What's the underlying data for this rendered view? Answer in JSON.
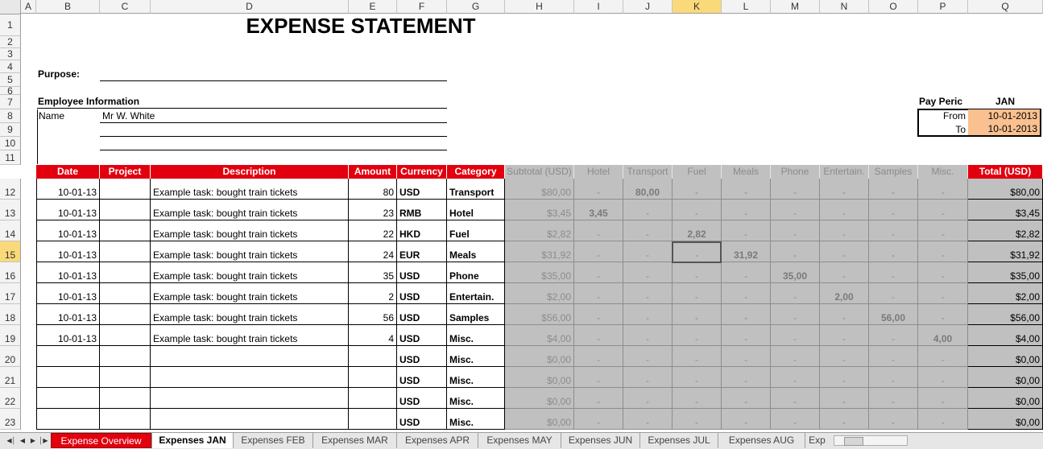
{
  "columns": [
    "A",
    "B",
    "C",
    "D",
    "E",
    "F",
    "G",
    "H",
    "I",
    "J",
    "K",
    "L",
    "M",
    "N",
    "O",
    "P",
    "Q"
  ],
  "selected_column": "K",
  "rows": [
    "1",
    "2",
    "3",
    "4",
    "5",
    "6",
    "7",
    "8",
    "9",
    "10",
    "11",
    "12",
    "13",
    "14",
    "15",
    "16",
    "17",
    "18",
    "19",
    "20",
    "21",
    "22",
    "23"
  ],
  "selected_row": "15",
  "sheet": {
    "title": "EXPENSE STATEMENT",
    "purpose_label": "Purpose:",
    "employee_info_label": "Employee Information",
    "name_label": "Name",
    "name_value": "Mr W. White",
    "pay_period_label": "Pay Peric",
    "pay_period_month": "JAN",
    "from_label": "From",
    "from_value": "10-01-2013",
    "to_label": "To",
    "to_value": "10-01-2013"
  },
  "table": {
    "headers": [
      "Date",
      "Project",
      "Description",
      "Amount",
      "Currency",
      "Category",
      "Subtotal (USD)",
      "Hotel",
      "Transport",
      "Fuel",
      "Meals",
      "Phone",
      "Entertain.",
      "Samples",
      "Misc.",
      "Total (USD)"
    ],
    "rows": [
      {
        "date": "10-01-13",
        "project": "",
        "description": "Example task: bought train tickets",
        "amount": "80",
        "currency": "USD",
        "category": "Transport",
        "subtotal": "$80,00",
        "hotel": "-",
        "transport": "80,00",
        "fuel": "-",
        "meals": "-",
        "phone": "-",
        "entertain": "-",
        "samples": "-",
        "misc": "-",
        "total": "$80,00"
      },
      {
        "date": "10-01-13",
        "project": "",
        "description": "Example task: bought train tickets",
        "amount": "23",
        "currency": "RMB",
        "category": "Hotel",
        "subtotal": "$3,45",
        "hotel": "3,45",
        "transport": "-",
        "fuel": "-",
        "meals": "-",
        "phone": "-",
        "entertain": "-",
        "samples": "-",
        "misc": "-",
        "total": "$3,45"
      },
      {
        "date": "10-01-13",
        "project": "",
        "description": "Example task: bought train tickets",
        "amount": "22",
        "currency": "HKD",
        "category": "Fuel",
        "subtotal": "$2,82",
        "hotel": "-",
        "transport": "-",
        "fuel": "2,82",
        "meals": "-",
        "phone": "-",
        "entertain": "-",
        "samples": "-",
        "misc": "-",
        "total": "$2,82"
      },
      {
        "date": "10-01-13",
        "project": "",
        "description": "Example task: bought train tickets",
        "amount": "24",
        "currency": "EUR",
        "category": "Meals",
        "subtotal": "$31,92",
        "hotel": "-",
        "transport": "-",
        "fuel": "-",
        "meals": "31,92",
        "phone": "-",
        "entertain": "-",
        "samples": "-",
        "misc": "-",
        "total": "$31,92"
      },
      {
        "date": "10-01-13",
        "project": "",
        "description": "Example task: bought train tickets",
        "amount": "35",
        "currency": "USD",
        "category": "Phone",
        "subtotal": "$35,00",
        "hotel": "-",
        "transport": "-",
        "fuel": "-",
        "meals": "-",
        "phone": "35,00",
        "entertain": "-",
        "samples": "-",
        "misc": "-",
        "total": "$35,00"
      },
      {
        "date": "10-01-13",
        "project": "",
        "description": "Example task: bought train tickets",
        "amount": "2",
        "currency": "USD",
        "category": "Entertain.",
        "subtotal": "$2,00",
        "hotel": "-",
        "transport": "-",
        "fuel": "-",
        "meals": "-",
        "phone": "-",
        "entertain": "2,00",
        "samples": "-",
        "misc": "-",
        "total": "$2,00"
      },
      {
        "date": "10-01-13",
        "project": "",
        "description": "Example task: bought train tickets",
        "amount": "56",
        "currency": "USD",
        "category": "Samples",
        "subtotal": "$56,00",
        "hotel": "-",
        "transport": "-",
        "fuel": "-",
        "meals": "-",
        "phone": "-",
        "entertain": "-",
        "samples": "56,00",
        "misc": "-",
        "total": "$56,00"
      },
      {
        "date": "10-01-13",
        "project": "",
        "description": "Example task: bought train tickets",
        "amount": "4",
        "currency": "USD",
        "category": "Misc.",
        "subtotal": "$4,00",
        "hotel": "-",
        "transport": "-",
        "fuel": "-",
        "meals": "-",
        "phone": "-",
        "entertain": "-",
        "samples": "-",
        "misc": "4,00",
        "total": "$4,00"
      },
      {
        "date": "",
        "project": "",
        "description": "",
        "amount": "",
        "currency": "USD",
        "category": "Misc.",
        "subtotal": "$0,00",
        "hotel": "-",
        "transport": "-",
        "fuel": "-",
        "meals": "-",
        "phone": "-",
        "entertain": "-",
        "samples": "-",
        "misc": "-",
        "total": "$0,00"
      },
      {
        "date": "",
        "project": "",
        "description": "",
        "amount": "",
        "currency": "USD",
        "category": "Misc.",
        "subtotal": "$0,00",
        "hotel": "-",
        "transport": "-",
        "fuel": "-",
        "meals": "-",
        "phone": "-",
        "entertain": "-",
        "samples": "-",
        "misc": "-",
        "total": "$0,00"
      },
      {
        "date": "",
        "project": "",
        "description": "",
        "amount": "",
        "currency": "USD",
        "category": "Misc.",
        "subtotal": "$0,00",
        "hotel": "-",
        "transport": "-",
        "fuel": "-",
        "meals": "-",
        "phone": "-",
        "entertain": "-",
        "samples": "-",
        "misc": "-",
        "total": "$0,00"
      },
      {
        "date": "",
        "project": "",
        "description": "",
        "amount": "",
        "currency": "USD",
        "category": "Misc.",
        "subtotal": "$0,00",
        "hotel": "-",
        "transport": "-",
        "fuel": "-",
        "meals": "-",
        "phone": "-",
        "entertain": "-",
        "samples": "-",
        "misc": "-",
        "total": "$0,00"
      }
    ]
  },
  "tabs": {
    "nav_icons": [
      "first-sheet-icon",
      "prev-sheet-icon",
      "next-sheet-icon",
      "last-sheet-icon"
    ],
    "items": [
      "Expense Overview",
      "Expenses JAN",
      "Expenses FEB",
      "Expenses MAR",
      "Expenses APR",
      "Expenses MAY",
      "Expenses JUN",
      "Expenses JUL",
      "Expenses AUG",
      "Exp"
    ],
    "active": "Expenses JAN",
    "colors": {
      "overview": "#e2000f",
      "header_red": "#e2000f",
      "pay_value": "#fac090",
      "calc_gray": "#c0c0c0"
    }
  }
}
